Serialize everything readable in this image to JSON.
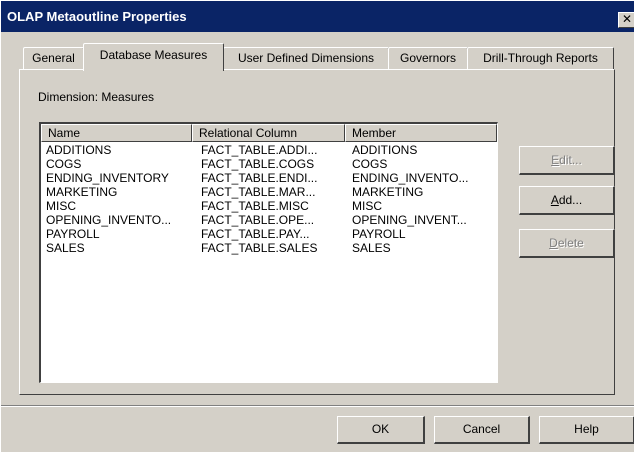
{
  "window": {
    "title": "OLAP Metaoutline Properties",
    "close_label": "✕"
  },
  "tabs": [
    {
      "label": "General",
      "active": false
    },
    {
      "label": "Database Measures",
      "active": true
    },
    {
      "label": "User Defined Dimensions",
      "active": false
    },
    {
      "label": "Governors",
      "active": false
    },
    {
      "label": "Drill-Through Reports",
      "active": false
    }
  ],
  "panel": {
    "dimension_label": "Dimension: Measures"
  },
  "table": {
    "columns": [
      "Name",
      "Relational Column",
      "Member"
    ],
    "rows": [
      [
        "ADDITIONS",
        "FACT_TABLE.ADDI...",
        "ADDITIONS"
      ],
      [
        "COGS",
        "FACT_TABLE.COGS",
        "COGS"
      ],
      [
        "ENDING_INVENTORY",
        "FACT_TABLE.ENDI...",
        "ENDING_INVENTO..."
      ],
      [
        "MARKETING",
        "FACT_TABLE.MAR...",
        "MARKETING"
      ],
      [
        "MISC",
        "FACT_TABLE.MISC",
        "MISC"
      ],
      [
        "OPENING_INVENTO...",
        "FACT_TABLE.OPE...",
        "OPENING_INVENT..."
      ],
      [
        "PAYROLL",
        "FACT_TABLE.PAY...",
        "PAYROLL"
      ],
      [
        "SALES",
        "FACT_TABLE.SALES",
        "SALES"
      ]
    ]
  },
  "side_buttons": {
    "edit": {
      "prefix": "",
      "accel": "E",
      "suffix": "dit...",
      "enabled": false
    },
    "add": {
      "prefix": "",
      "accel": "A",
      "suffix": "dd...",
      "enabled": true
    },
    "delete": {
      "prefix": "",
      "accel": "D",
      "suffix": "elete",
      "enabled": false
    }
  },
  "footer": {
    "ok_label": "OK",
    "cancel_label": "Cancel",
    "help_label": "Help"
  },
  "colors": {
    "titlebar": "#0a2466",
    "face": "#d4d0c8",
    "disabled_text": "#808080"
  }
}
